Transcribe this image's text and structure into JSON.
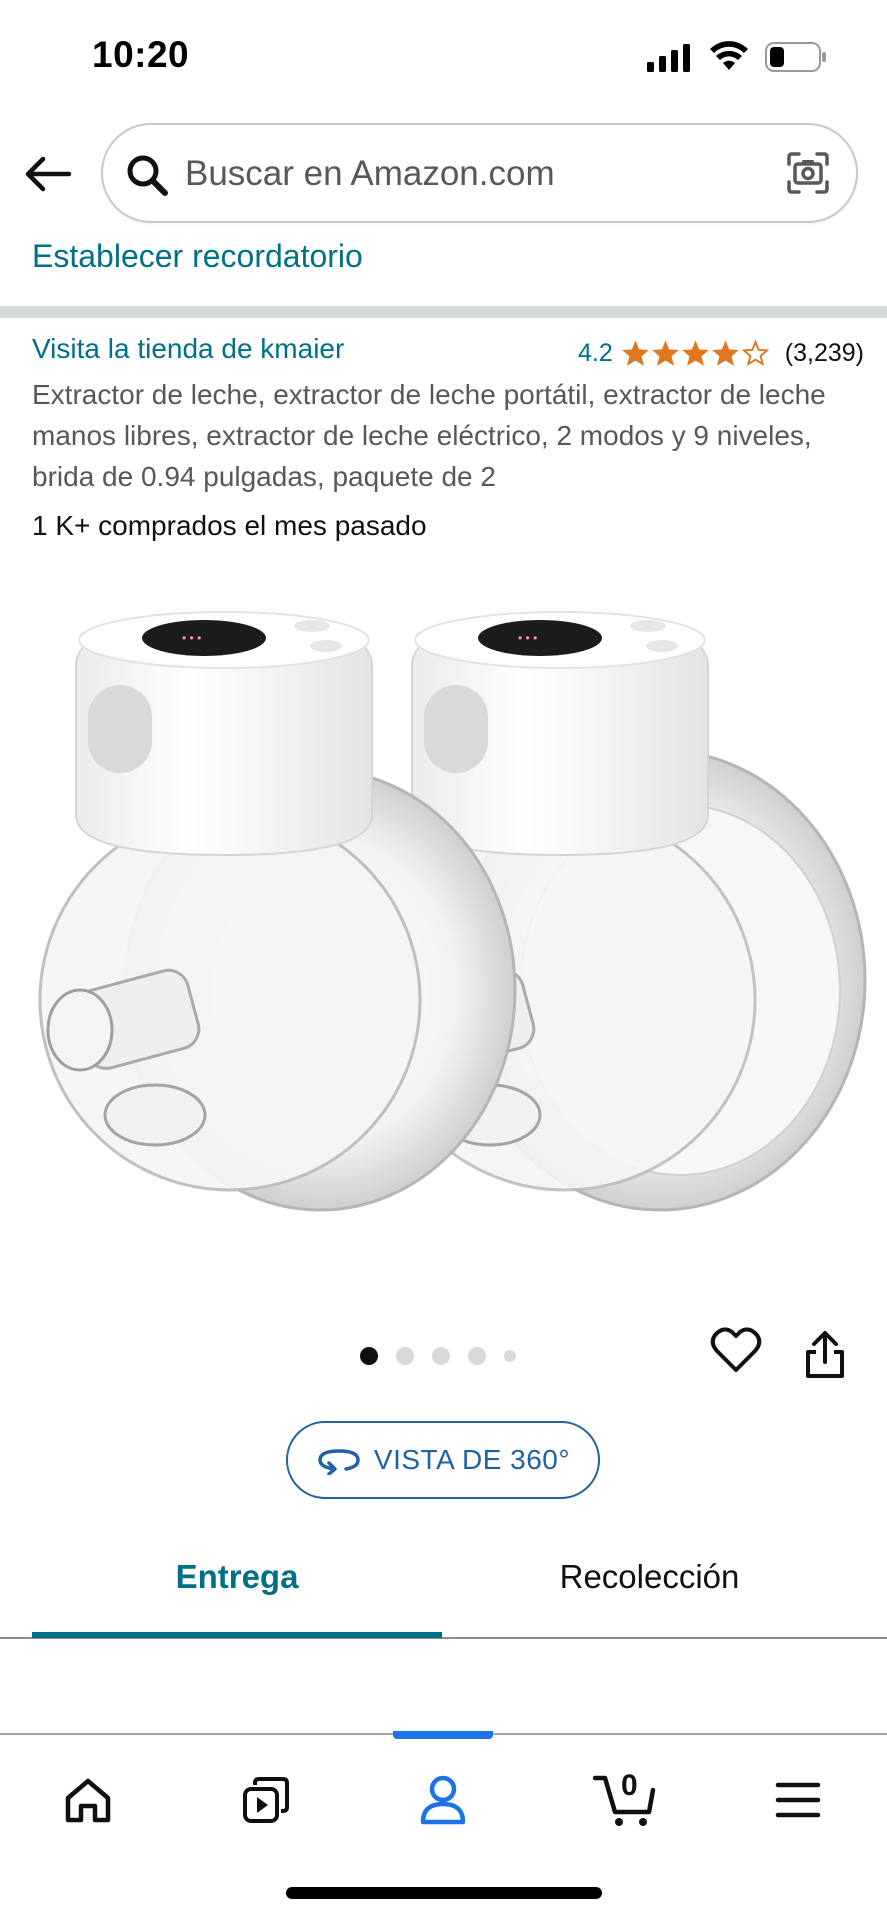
{
  "status_bar": {
    "time": "10:20"
  },
  "search": {
    "placeholder": "Buscar en Amazon.com"
  },
  "reminder": {
    "label": "Establecer recordatorio"
  },
  "product": {
    "store_link": "Visita la tienda de kmaier",
    "rating_value": "4.2",
    "rating_stars": 4.2,
    "rating_count": "(3,239)",
    "title": "Extractor de leche, extractor de leche portátil, extractor de leche manos libres, extractor de leche eléctrico, 2 modos y 9 niveles, brida de 0.94 pulgadas, paquete de 2",
    "bought": "1 K+ comprados el mes pasado"
  },
  "carousel": {
    "total_images": 5,
    "active_index": 0
  },
  "view360": {
    "label": "VISTA DE 360°"
  },
  "tabs": [
    {
      "label": "Entrega",
      "active": true
    },
    {
      "label": "Recolección",
      "active": false
    }
  ],
  "bottom_nav": {
    "items": [
      {
        "icon": "home-icon"
      },
      {
        "icon": "video-icon"
      },
      {
        "icon": "account-icon",
        "active": true
      },
      {
        "icon": "cart-icon"
      },
      {
        "icon": "menu-icon"
      }
    ],
    "cart_count": "0"
  },
  "colors": {
    "link_teal": "#007185",
    "rating_star": "#de7921",
    "view360_blue": "#2162a1",
    "active_nav": "#1a73e8"
  }
}
